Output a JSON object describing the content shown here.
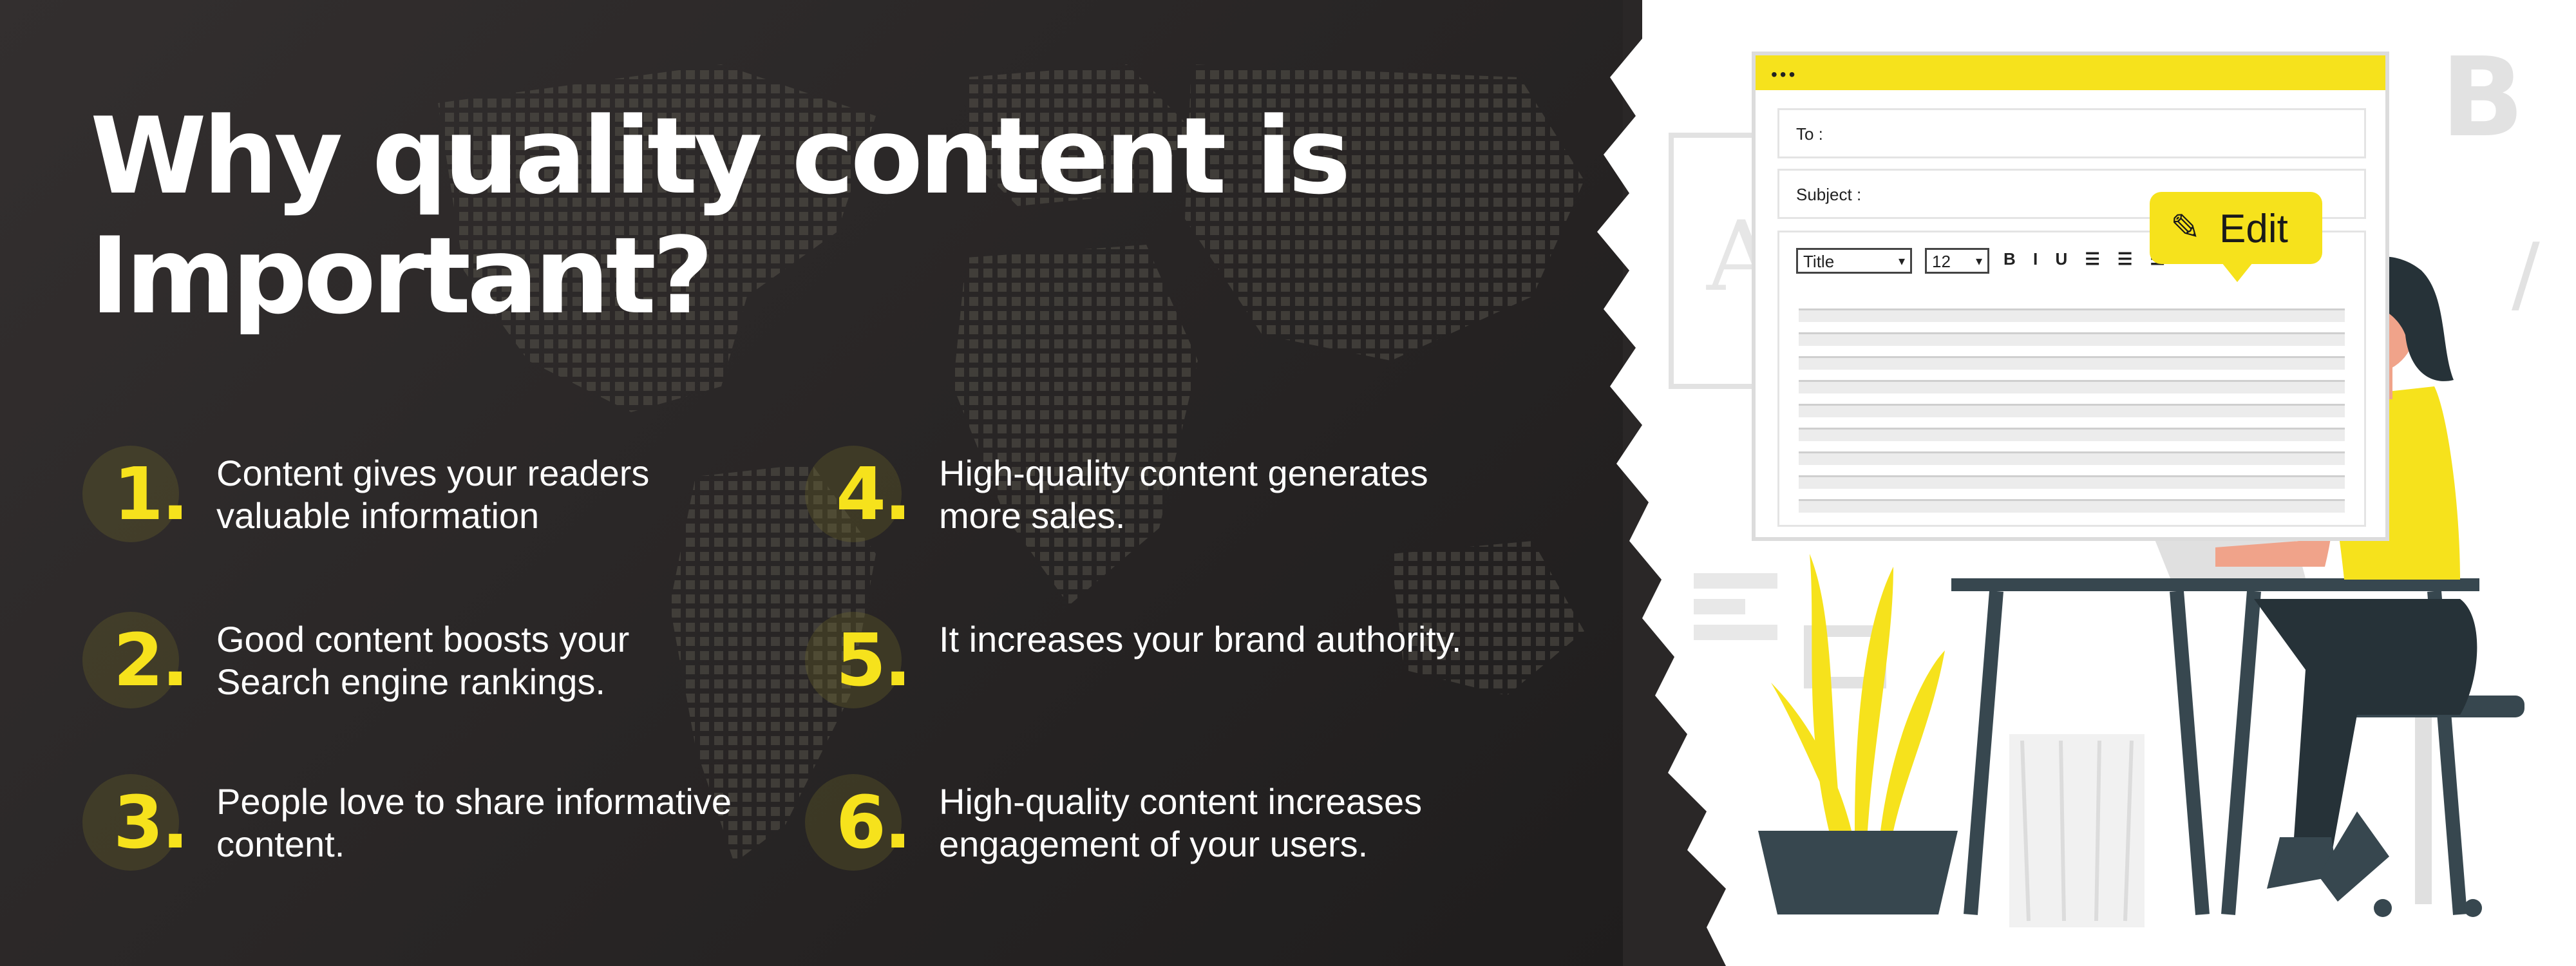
{
  "title": {
    "line1": "Why quality content is",
    "line2": "Important?"
  },
  "items": [
    {
      "number": "1.",
      "text": "Content gives your readers valuable information"
    },
    {
      "number": "2.",
      "text": "Good content boosts your Search engine rankings."
    },
    {
      "number": "3.",
      "text": "People love to share informative content."
    },
    {
      "number": "4.",
      "text": "High-quality content generates more sales."
    },
    {
      "number": "5.",
      "text": "It increases your brand authority."
    },
    {
      "number": "6.",
      "text": "High-quality content increases engagement of your users."
    }
  ],
  "illustration": {
    "email": {
      "window_dots": "•••",
      "to_label": "To :",
      "subject_label": "Subject :",
      "style_select": "Title",
      "size_select": "12",
      "format_buttons": "B I U ☰ ☰ ☰"
    },
    "edit_bubble": {
      "icon": "pencil-icon",
      "label": "Edit"
    },
    "decor_letters": [
      "A",
      "B",
      "/"
    ]
  },
  "colors": {
    "accent_yellow": "#f6e21c",
    "dark_background": "#2a2727",
    "text_white": "#ffffff",
    "desk_dark": "#37474f"
  }
}
